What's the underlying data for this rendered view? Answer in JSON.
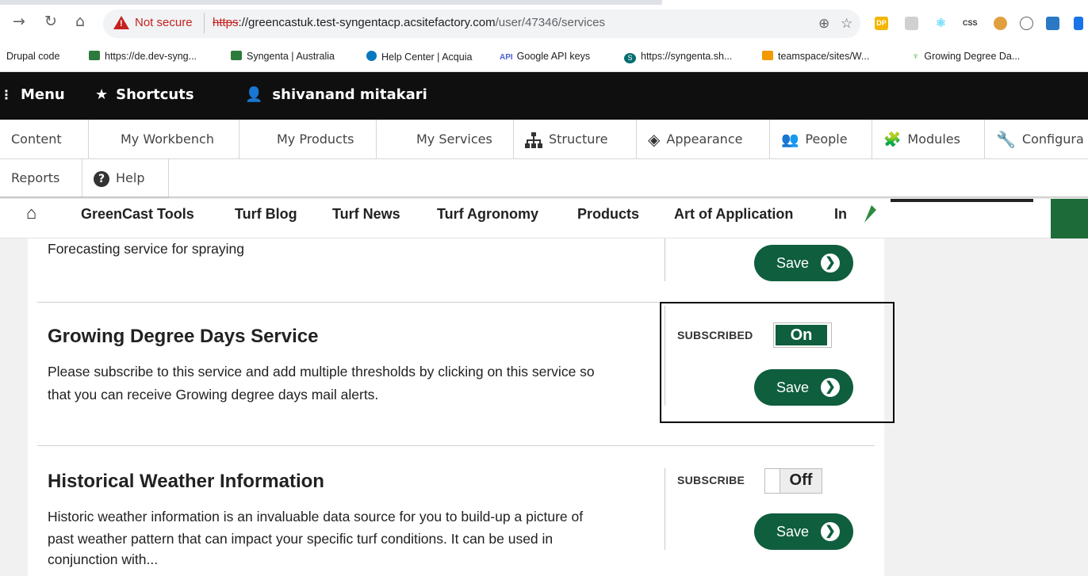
{
  "browser": {
    "url_warning": "Not secure",
    "url_scheme": "https",
    "url_host": "://greencastuk.test-syngentacp.acsitefactory.com",
    "url_path": "/user/47346/services",
    "bookmarks": [
      "Drupal code",
      "https://de.dev-syng...",
      "Syngenta | Australia",
      "Help Center | Acquia",
      "Google API keys",
      "https://syngenta.sh...",
      "teamspace/sites/W...",
      "Growing Degree Da..."
    ],
    "bookmark_badges": {
      "api": "API",
      "s": "S",
      "dp": "DP",
      "css": "CSS"
    }
  },
  "admin_toolbar": {
    "menu": "Menu",
    "shortcuts": "Shortcuts",
    "user": "shivanand mitakari"
  },
  "admin_tray": {
    "row1": [
      "Content",
      "My Workbench",
      "My Products",
      "My Services",
      "Structure",
      "Appearance",
      "People",
      "Modules",
      "Configura"
    ],
    "row2": [
      "Reports",
      "Help"
    ]
  },
  "site_nav": {
    "links": [
      "GreenCast Tools",
      "Turf Blog",
      "Turf News",
      "Turf Agronomy",
      "Products",
      "Art of Application",
      "In"
    ]
  },
  "services": [
    {
      "description": "Forecasting service for spraying",
      "save_label": "Save"
    },
    {
      "title": "Growing Degree Days Service",
      "description_line1": "Please subscribe to this service and add multiple thresholds by clicking on this service so",
      "description_line2": "that you can receive Growing degree days mail alerts.",
      "status_label": "SUBSCRIBED",
      "toggle_value": "On",
      "save_label": "Save"
    },
    {
      "title": "Historical Weather Information",
      "description_line1": "Historic weather information is an invaluable data source for you to build-up a picture of",
      "description_line2": "past weather pattern that can impact your specific turf conditions. It can be used in",
      "description_line3": "conjunction with...",
      "status_label": "SUBSCRIBE",
      "toggle_value": "Off",
      "save_label": "Save"
    }
  ]
}
